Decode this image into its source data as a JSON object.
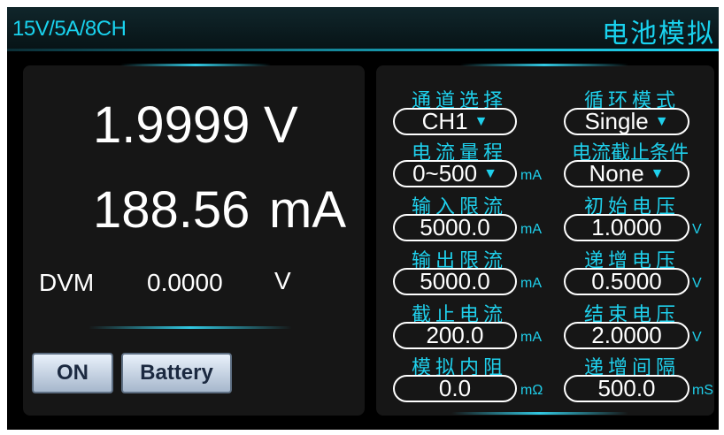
{
  "header": {
    "model": "15V/5A/8CH",
    "title": "电池模拟"
  },
  "measure": {
    "voltage_value": "1.9999",
    "voltage_unit": "V",
    "current_value": "188.56",
    "current_unit": "mA",
    "dvm_label": "DVM",
    "dvm_value": "0.0000",
    "dvm_unit": "V"
  },
  "buttons": {
    "on": "ON",
    "battery": "Battery"
  },
  "settings": {
    "channel_label": "通道选择",
    "channel_value": "CH1",
    "loop_label": "循环模式",
    "loop_value": "Single",
    "range_label": "电流量程",
    "range_value": "0~500",
    "range_unit": "mA",
    "cutoff_cond_label": "电流截止条件",
    "cutoff_cond_value": "None",
    "input_limit_label": "输入限流",
    "input_limit_value": "5000.0",
    "input_limit_unit": "mA",
    "init_voltage_label": "初始电压",
    "init_voltage_value": "1.0000",
    "init_voltage_unit": "V",
    "output_limit_label": "输出限流",
    "output_limit_value": "5000.0",
    "output_limit_unit": "mA",
    "step_voltage_label": "递增电压",
    "step_voltage_value": "0.5000",
    "step_voltage_unit": "V",
    "cutoff_current_label": "截止电流",
    "cutoff_current_value": "200.0",
    "cutoff_current_unit": "mA",
    "end_voltage_label": "结束电压",
    "end_voltage_value": "2.0000",
    "end_voltage_unit": "V",
    "internal_res_label": "模拟内阻",
    "internal_res_value": "0.0",
    "internal_res_unit": "mΩ",
    "step_interval_label": "递增间隔",
    "step_interval_value": "500.0",
    "step_interval_unit": "mS"
  },
  "icons": {
    "dropdown": "dropdown-triangle-icon"
  },
  "colors": {
    "accent": "#1fd0ec",
    "background": "#000000",
    "panel": "#161616"
  }
}
